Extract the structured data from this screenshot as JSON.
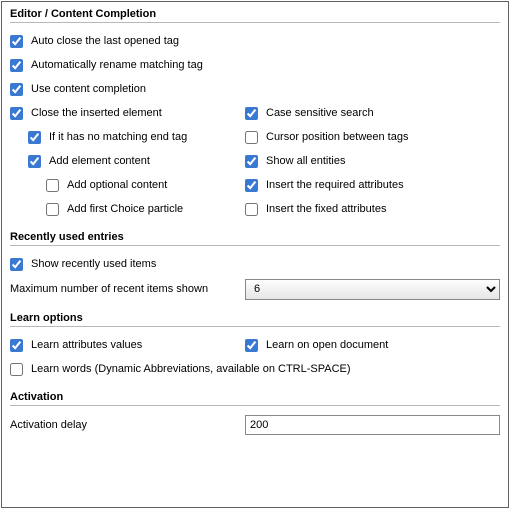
{
  "header": "Editor / Content Completion",
  "opts": {
    "auto_close": {
      "label": "Auto close the last opened tag",
      "checked": true
    },
    "auto_rename": {
      "label": "Automatically rename matching tag",
      "checked": true
    },
    "use_cc": {
      "label": "Use content completion",
      "checked": true
    },
    "close_inserted": {
      "label": "Close the inserted element",
      "checked": true
    },
    "if_no_match": {
      "label": "If it has no matching end tag",
      "checked": true
    },
    "add_elem_content": {
      "label": "Add element content",
      "checked": true
    },
    "add_optional": {
      "label": "Add optional content",
      "checked": false
    },
    "add_first_choice": {
      "label": "Add first Choice particle",
      "checked": false
    },
    "case_sensitive": {
      "label": "Case sensitive search",
      "checked": true
    },
    "cursor_between": {
      "label": "Cursor position between tags",
      "checked": false
    },
    "show_all_entities": {
      "label": "Show all entities",
      "checked": true
    },
    "insert_required": {
      "label": "Insert the required attributes",
      "checked": true
    },
    "insert_fixed": {
      "label": "Insert the fixed attributes",
      "checked": false
    }
  },
  "recent": {
    "header": "Recently used entries",
    "show": {
      "label": "Show recently used items",
      "checked": true
    },
    "max_label": "Maximum number of recent items shown",
    "max_value": "6"
  },
  "learn": {
    "header": "Learn options",
    "attr_values": {
      "label": "Learn attributes values",
      "checked": true
    },
    "on_open": {
      "label": "Learn on open document",
      "checked": true
    },
    "words": {
      "label": "Learn words (Dynamic Abbreviations, available on CTRL-SPACE)",
      "checked": false
    }
  },
  "activation": {
    "header": "Activation",
    "delay_label": "Activation delay",
    "delay_value": "200"
  }
}
